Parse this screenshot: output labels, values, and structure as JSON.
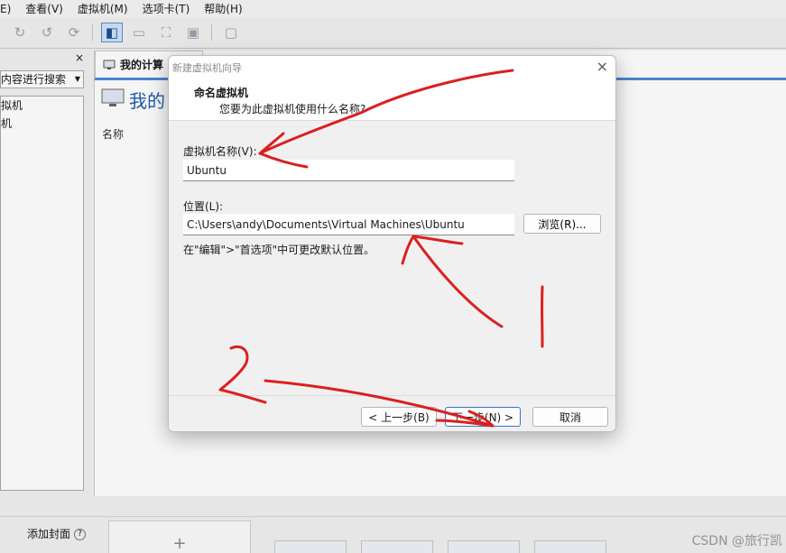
{
  "menubar": {
    "items": [
      "E)",
      "查看(V)",
      "虚拟机(M)",
      "选项卡(T)",
      "帮助(H)"
    ]
  },
  "library": {
    "close": "×",
    "search_placeholder": "内容进行搜索",
    "tree_items": [
      "拟机",
      "机"
    ]
  },
  "content": {
    "tab_title": "我的计算",
    "page_title": "我的",
    "column_name": "名称"
  },
  "dialog": {
    "title": "新建虚拟机向导",
    "close": "×",
    "header_title": "命名虚拟机",
    "header_subtitle": "您要为此虚拟机使用什么名称?",
    "name_label": "虚拟机名称(V):",
    "name_value": "Ubuntu",
    "location_label": "位置(L):",
    "location_value": "C:\\Users\\andy\\Documents\\Virtual Machines\\Ubuntu",
    "browse_label": "浏览(R)...",
    "hint": "在\"编辑\">\"首选项\"中可更改默认位置。",
    "back_label": "< 上一步(B)",
    "next_label": "下一步(N) >",
    "cancel_label": "取消"
  },
  "bottom": {
    "cover_label": "添加封面",
    "help": "?",
    "add": "+",
    "watermark": "CSDN @旅行凯"
  },
  "annotations": {
    "color": "#d92121",
    "label_one": "1",
    "label_two": "2"
  }
}
